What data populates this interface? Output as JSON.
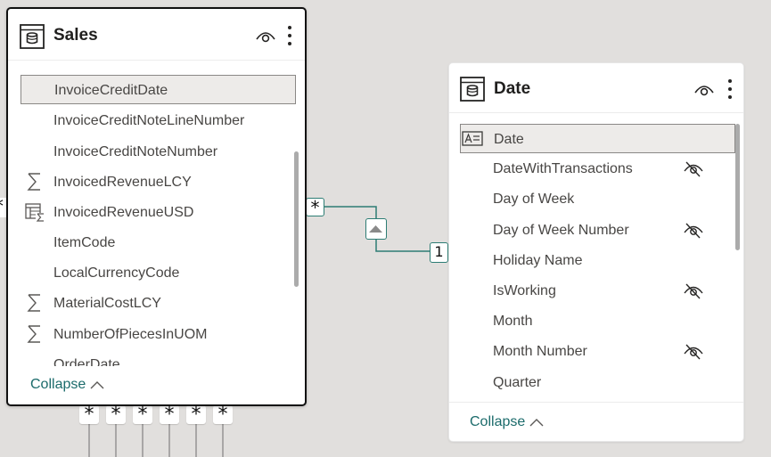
{
  "colors": {
    "canvas": "#e1dfdd",
    "relationship_line": "#2d7d74",
    "collapse_link": "#1b6b6b",
    "selected_row": "#edebe9"
  },
  "relationship": {
    "from_cardinality": "*",
    "to_cardinality": "1",
    "direction_icon": "triangle-up-icon",
    "left_edge_cardinality": "*",
    "bottom_cardinalities": [
      "*",
      "*",
      "*",
      "*",
      "*",
      "*"
    ]
  },
  "sales_table": {
    "title": "Sales",
    "icon": "table-icon",
    "header_icons": [
      "eye-icon",
      "more-options-icon"
    ],
    "fields": [
      {
        "name": "InvoiceCreditDate",
        "icon": "",
        "selected": true,
        "hidden": false
      },
      {
        "name": "InvoiceCreditNoteLineNumber",
        "icon": "",
        "selected": false,
        "hidden": false
      },
      {
        "name": "InvoiceCreditNoteNumber",
        "icon": "",
        "selected": false,
        "hidden": false
      },
      {
        "name": "InvoicedRevenueLCY",
        "icon": "sigma-icon",
        "selected": false,
        "hidden": false
      },
      {
        "name": "InvoicedRevenueUSD",
        "icon": "calculated-column-icon",
        "selected": false,
        "hidden": false
      },
      {
        "name": "ItemCode",
        "icon": "",
        "selected": false,
        "hidden": false
      },
      {
        "name": "LocalCurrencyCode",
        "icon": "",
        "selected": false,
        "hidden": false
      },
      {
        "name": "MaterialCostLCY",
        "icon": "sigma-icon",
        "selected": false,
        "hidden": false
      },
      {
        "name": "NumberOfPiecesInUOM",
        "icon": "sigma-icon",
        "selected": false,
        "hidden": false
      },
      {
        "name": "OrderDate",
        "icon": "",
        "selected": false,
        "hidden": false
      }
    ],
    "collapse_label": "Collapse"
  },
  "date_table": {
    "title": "Date",
    "icon": "table-icon",
    "header_icons": [
      "eye-icon",
      "more-options-icon"
    ],
    "fields": [
      {
        "name": "Date",
        "icon": "date-key-icon",
        "selected": true,
        "hidden": false
      },
      {
        "name": "DateWithTransactions",
        "icon": "",
        "selected": false,
        "hidden": true
      },
      {
        "name": "Day of Week",
        "icon": "",
        "selected": false,
        "hidden": false
      },
      {
        "name": "Day of Week Number",
        "icon": "",
        "selected": false,
        "hidden": true
      },
      {
        "name": "Holiday Name",
        "icon": "",
        "selected": false,
        "hidden": false
      },
      {
        "name": "IsWorking",
        "icon": "",
        "selected": false,
        "hidden": true
      },
      {
        "name": "Month",
        "icon": "",
        "selected": false,
        "hidden": false
      },
      {
        "name": "Month Number",
        "icon": "",
        "selected": false,
        "hidden": true
      },
      {
        "name": "Quarter",
        "icon": "",
        "selected": false,
        "hidden": false
      }
    ],
    "collapse_label": "Collapse"
  }
}
